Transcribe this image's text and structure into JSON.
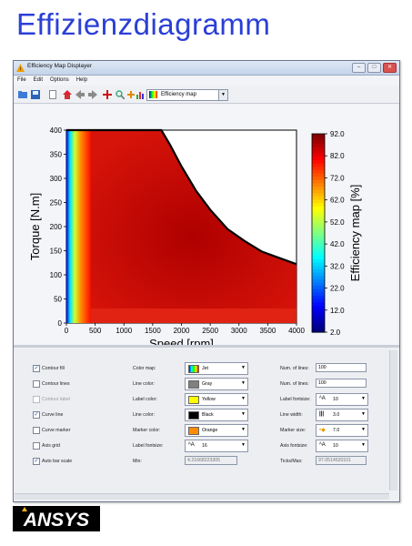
{
  "slide": {
    "title": "Effizienzdiagramm",
    "logo_text": "ANSYS"
  },
  "window": {
    "title": "Efficiency Map Displayer",
    "controls": [
      "–",
      "□",
      "✕"
    ],
    "menu": [
      "File",
      "Edit",
      "Options",
      "Help"
    ],
    "toolbar_icons": [
      "open-folder-icon",
      "save-icon",
      "new-page-icon",
      "home-icon",
      "back-arrow-icon",
      "forward-arrow-icon",
      "move-cross-icon",
      "zoom-icon",
      "add-icon",
      "chart-icon"
    ],
    "view_select": "Efficiency map"
  },
  "chart_data": {
    "type": "heatmap",
    "xlabel": "Speed [rpm]",
    "ylabel": "Torque [N.m]",
    "colorbar_label": "Efficiency map [%]",
    "xlim": [
      0,
      4000
    ],
    "ylim": [
      0,
      400
    ],
    "xticks": [
      "0",
      "500",
      "1000",
      "1500",
      "2000",
      "2500",
      "3000",
      "3500",
      "4000"
    ],
    "yticks": [
      "0",
      "50",
      "100",
      "150",
      "200",
      "250",
      "300",
      "350",
      "400"
    ],
    "colorbar_ticks": [
      "92.0",
      "82.0",
      "72.0",
      "62.0",
      "52.0",
      "42.0",
      "32.0",
      "22.0",
      "12.0",
      "2.0"
    ],
    "colormap": "jet",
    "color_range": [
      2.0,
      92.0
    ],
    "max_torque_curve": {
      "x": [
        0,
        1650,
        1800,
        2000,
        2250,
        2500,
        2800,
        3100,
        3400,
        3700,
        4000
      ],
      "y": [
        400,
        400,
        370,
        325,
        275,
        235,
        195,
        170,
        148,
        135,
        122
      ]
    }
  },
  "controls": {
    "col1": [
      {
        "label": "Contour fill",
        "checked": true,
        "disabled": false
      },
      {
        "label": "Contour lines",
        "checked": false,
        "disabled": false
      },
      {
        "label": "Contour label",
        "checked": false,
        "disabled": true
      },
      {
        "label": "Curve line",
        "checked": true,
        "disabled": false
      },
      {
        "label": "Curve marker",
        "checked": false,
        "disabled": false
      },
      {
        "label": "Axis grid",
        "checked": false,
        "disabled": false
      },
      {
        "label": "Auto bar scale",
        "checked": true,
        "disabled": false
      }
    ],
    "col2": [
      {
        "label": "Color map:",
        "value": "Jet",
        "swatch": "jet"
      },
      {
        "label": "Line color:",
        "value": "Gray",
        "swatch": "#808080"
      },
      {
        "label": "Label color:",
        "value": "Yellow",
        "swatch": "#ffff00"
      },
      {
        "label": "Line color:",
        "value": "Black",
        "swatch": "#000000"
      },
      {
        "label": "Marker color:",
        "value": "Orange",
        "swatch": "#ff8c00"
      },
      {
        "label": "Label fontsize:",
        "value": "16",
        "swatch": "fontsize"
      }
    ],
    "min_label": "Min:",
    "min_value": "4.21668223305",
    "col3": [
      {
        "label": "Num. of lines:",
        "value": "100",
        "type": "input"
      },
      {
        "label": "Num. of lines:",
        "value": "100",
        "type": "input"
      },
      {
        "label": "Label fontsize:",
        "value": "10",
        "type": "select",
        "icon": "fontsize"
      },
      {
        "label": "Line width:",
        "value": "3.0",
        "type": "select",
        "icon": "linewidth"
      },
      {
        "label": "Marker size:",
        "value": "7.0",
        "type": "select",
        "icon": "markersize"
      },
      {
        "label": "Axis fontsize:",
        "value": "10",
        "type": "select",
        "icon": "fontsize"
      }
    ],
    "ticks_label": "Ticks/Max:",
    "ticks_value": "97.0514520101"
  }
}
